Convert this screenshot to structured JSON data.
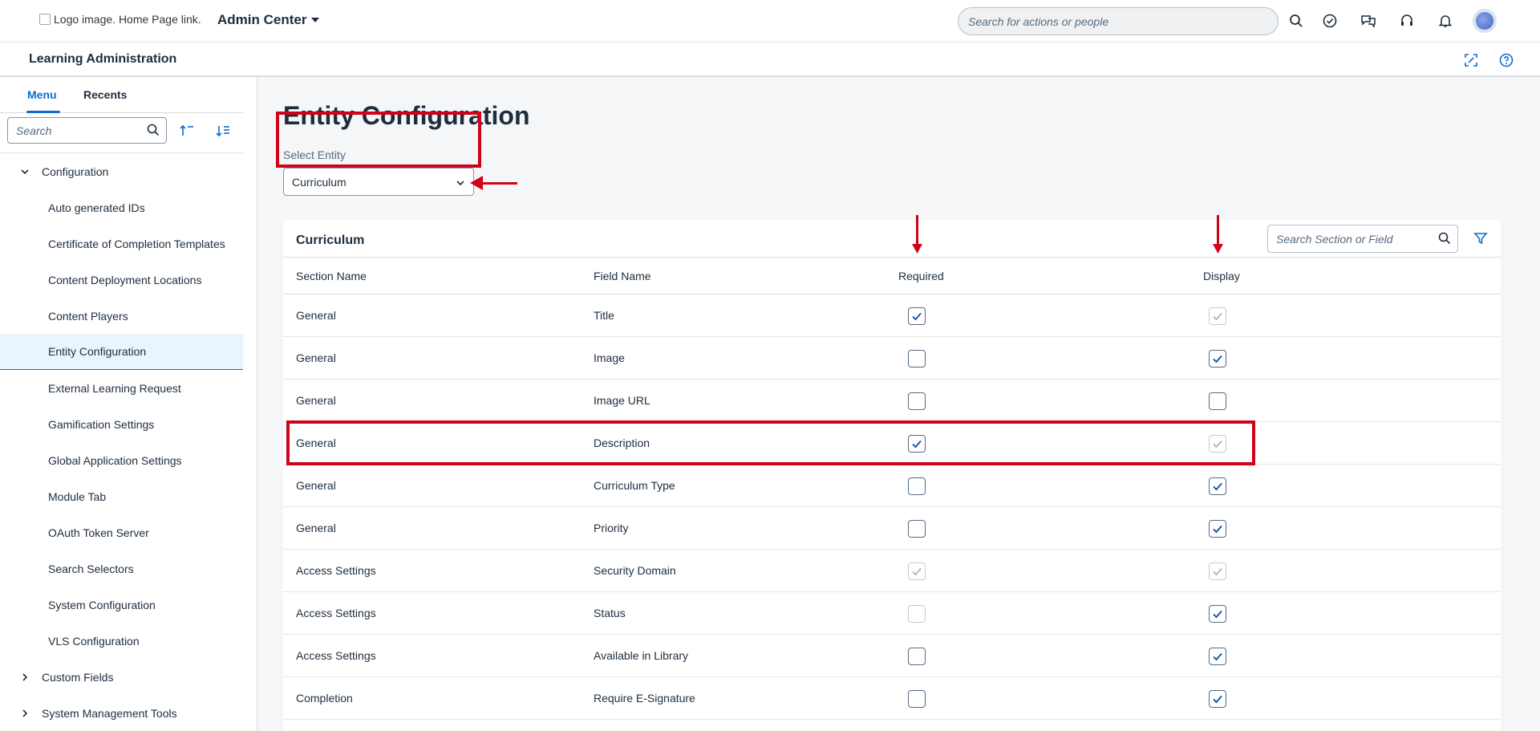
{
  "shell": {
    "logo_alt": "Logo image. Home Page link.",
    "app_title": "Admin Center",
    "search_placeholder": "Search for actions or people",
    "icons": [
      "search-icon",
      "check-circle-icon",
      "chat-icon",
      "headset-icon",
      "bell-icon"
    ]
  },
  "subheader": {
    "title": "Learning Administration",
    "icons": [
      "fullscreen-icon",
      "help-icon"
    ]
  },
  "sidebar": {
    "tabs": [
      {
        "label": "Menu",
        "active": true
      },
      {
        "label": "Recents",
        "active": false
      }
    ],
    "search_placeholder": "Search",
    "items": [
      {
        "label": "Configuration",
        "type": "group",
        "expanded": true
      },
      {
        "label": "Auto generated IDs",
        "type": "child"
      },
      {
        "label": "Certificate of Completion Templates",
        "type": "child"
      },
      {
        "label": "Content Deployment Locations",
        "type": "child"
      },
      {
        "label": "Content Players",
        "type": "child"
      },
      {
        "label": "Entity Configuration",
        "type": "child",
        "selected": true
      },
      {
        "label": "External Learning Request",
        "type": "child"
      },
      {
        "label": "Gamification Settings",
        "type": "child"
      },
      {
        "label": "Global Application Settings",
        "type": "child"
      },
      {
        "label": "Module Tab",
        "type": "child"
      },
      {
        "label": "OAuth Token Server",
        "type": "child"
      },
      {
        "label": "Search Selectors",
        "type": "child"
      },
      {
        "label": "System Configuration",
        "type": "child"
      },
      {
        "label": "VLS Configuration",
        "type": "child"
      },
      {
        "label": "Custom Fields",
        "type": "group",
        "expanded": false
      },
      {
        "label": "System Management Tools",
        "type": "group",
        "expanded": false
      }
    ]
  },
  "main": {
    "page_title": "Entity Configuration",
    "select_label": "Select Entity",
    "select_value": "Curriculum",
    "table": {
      "title": "Curriculum",
      "search_placeholder": "Search Section or Field",
      "columns": [
        "Section Name",
        "Field Name",
        "Required",
        "Display"
      ],
      "rows": [
        {
          "section": "General",
          "field": "Title",
          "required": {
            "checked": true,
            "disabled": false
          },
          "display": {
            "checked": true,
            "disabled": true
          }
        },
        {
          "section": "General",
          "field": "Image",
          "required": {
            "checked": false,
            "disabled": false
          },
          "display": {
            "checked": true,
            "disabled": false
          }
        },
        {
          "section": "General",
          "field": "Image URL",
          "required": {
            "checked": false,
            "disabled": false
          },
          "display": {
            "checked": false,
            "disabled": false
          }
        },
        {
          "section": "General",
          "field": "Description",
          "required": {
            "checked": true,
            "disabled": false
          },
          "display": {
            "checked": true,
            "disabled": true
          }
        },
        {
          "section": "General",
          "field": "Curriculum Type",
          "required": {
            "checked": false,
            "disabled": false
          },
          "display": {
            "checked": true,
            "disabled": false
          }
        },
        {
          "section": "General",
          "field": "Priority",
          "required": {
            "checked": false,
            "disabled": false
          },
          "display": {
            "checked": true,
            "disabled": false
          }
        },
        {
          "section": "Access Settings",
          "field": "Security Domain",
          "required": {
            "checked": true,
            "disabled": true
          },
          "display": {
            "checked": true,
            "disabled": true
          }
        },
        {
          "section": "Access Settings",
          "field": "Status",
          "required": {
            "checked": false,
            "disabled": true
          },
          "display": {
            "checked": true,
            "disabled": false
          }
        },
        {
          "section": "Access Settings",
          "field": "Available in Library",
          "required": {
            "checked": false,
            "disabled": false
          },
          "display": {
            "checked": true,
            "disabled": false
          }
        },
        {
          "section": "Completion",
          "field": "Require E-Signature",
          "required": {
            "checked": false,
            "disabled": false
          },
          "display": {
            "checked": true,
            "disabled": false
          }
        }
      ]
    }
  },
  "colors": {
    "accent": "#0a6ed1",
    "annotation_red": "#d0021b"
  }
}
